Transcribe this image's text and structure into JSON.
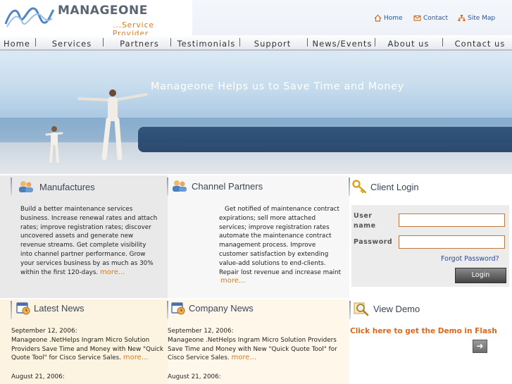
{
  "brand": {
    "name": "MANAGEONE",
    "tagline": "...Service Provider"
  },
  "toplinks": [
    {
      "label": "Home",
      "icon": "home-icon"
    },
    {
      "label": "Contact",
      "icon": "mail-icon"
    },
    {
      "label": "Site Map",
      "icon": "sitemap-icon"
    }
  ],
  "nav": [
    "Home",
    "Services",
    "Partners",
    "Testimonials",
    "Support",
    "News/Events",
    "About us",
    "Contact us"
  ],
  "banner": {
    "caption": "Manageone  Helps us to Save Time and Money"
  },
  "manufactures": {
    "title": "Manufactures",
    "body": "Build a better maintenance services business. Increase renewal rates and attach rates; improve registration rates; discover uncovered assets and generate new revenue streams. Get complete visibility into channel partner performance. Grow your services business by as much as 30% within the first 120-days.",
    "more": "more..."
  },
  "channel": {
    "title": "Channel Partners",
    "body": "Get notified of maintenance contract expirations; sell more attached services; improve registration rates automate the maintenance contract management process. Improve customer satisfaction by extending value-add solutions to end-clients. Repair lost revenue and increase maint",
    "more": "more..."
  },
  "login": {
    "title": "Client Login",
    "user_label": "User name",
    "password_label": "Password",
    "forgot": "Forgot Password?",
    "button": "Login"
  },
  "latest_news": {
    "title": "Latest News",
    "item1_date": "September 12, 2006:",
    "item1_text": "Manageone .NetHelps Ingram Micro Solution Providers Save Time and Money with New \"Quick Quote Tool\" for Cisco Service Sales.",
    "item1_more": "more...",
    "item2_date": "August 21, 2006:"
  },
  "company_news": {
    "title": "Company News",
    "item1_date": "September 12, 2006:",
    "item1_text": "Manageone .NetHelps Ingram Micro Solution Providers Save Time and Money with New \"Quick Quote Tool\" for Cisco Service Sales.",
    "item1_more": "more...",
    "item2_date": "August 21, 2006:"
  },
  "demo": {
    "title": "View Demo",
    "link": "Click here to get the Demo in Flash"
  },
  "colors": {
    "accent": "#e07a1a",
    "link": "#2a55a0",
    "caption_bar": "#1e3d63"
  }
}
